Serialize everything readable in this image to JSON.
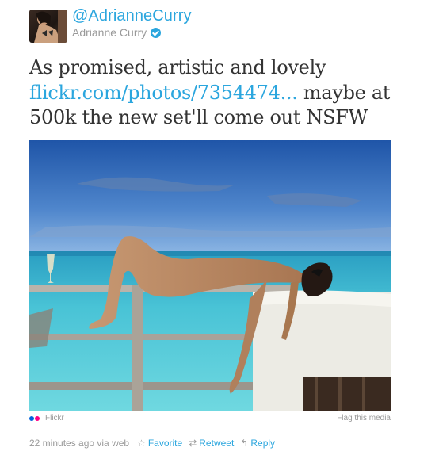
{
  "author": {
    "handle": "@AdrianneCurry",
    "display_name": "Adrianne Curry",
    "verified": true
  },
  "tweet": {
    "text_before_link": "As promised, artistic and lovely ",
    "link_text": "flickr.com/photos/7354474...",
    "text_after_link": " maybe at 500k the new set'll come out NSFW"
  },
  "media": {
    "source_label": "Flickr",
    "flag_label": "Flag this media",
    "image_description_icon": "photo"
  },
  "meta": {
    "timestamp": "22 minutes ago via web",
    "favorite_label": "Favorite",
    "retweet_label": "Retweet",
    "reply_label": "Reply",
    "favorite_icon": "star-icon",
    "retweet_icon": "retweet-icon",
    "reply_icon": "reply-icon"
  },
  "colors": {
    "link": "#2ba6de",
    "muted": "#999999",
    "text": "#333333",
    "flickr_blue": "#0063dc",
    "flickr_pink": "#ff0084"
  }
}
